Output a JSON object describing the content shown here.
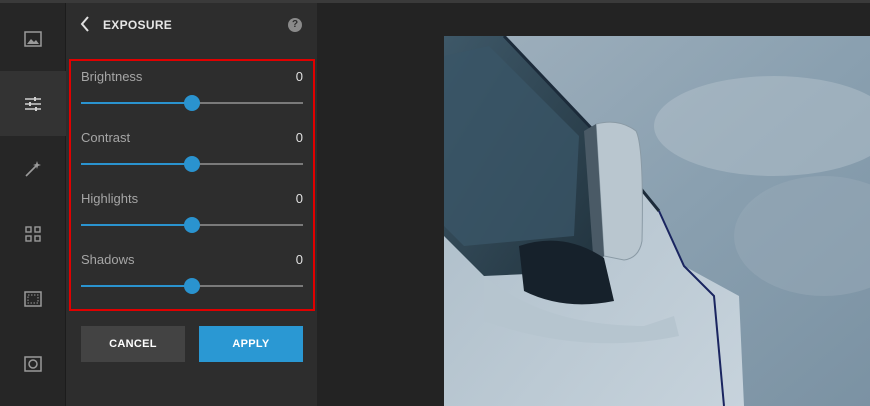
{
  "sidebar": {
    "items": [
      {
        "icon": "image-icon",
        "active": false
      },
      {
        "icon": "sliders-icon",
        "active": true
      },
      {
        "icon": "magic-wand-icon",
        "active": false
      },
      {
        "icon": "grid-icon",
        "active": false
      },
      {
        "icon": "frame-icon",
        "active": false
      },
      {
        "icon": "vignette-icon",
        "active": false
      }
    ]
  },
  "panel": {
    "title": "EXPOSURE",
    "help": "?",
    "sliders": [
      {
        "label": "Brightness",
        "value": "0",
        "level": 0.5
      },
      {
        "label": "Contrast",
        "value": "0",
        "level": 0.5
      },
      {
        "label": "Highlights",
        "value": "0",
        "level": 0.5
      },
      {
        "label": "Shadows",
        "value": "0",
        "level": 0.5
      }
    ],
    "cancel_label": "CANCEL",
    "apply_label": "APPLY"
  },
  "colors": {
    "accent": "#2a93cf",
    "highlight_border": "#e00000",
    "panel_bg": "#2d2d2d"
  }
}
